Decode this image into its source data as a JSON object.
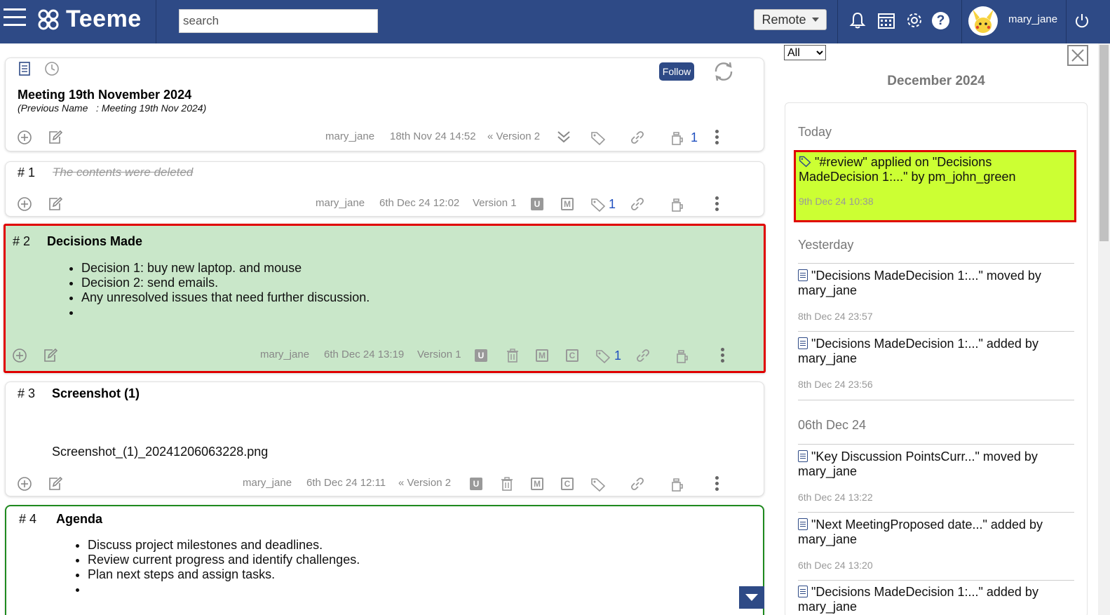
{
  "app": {
    "name": "Teeme"
  },
  "header": {
    "search_placeholder": "search",
    "mode_label": "Remote",
    "username": "mary_jane"
  },
  "doc": {
    "follow_label": "Follow",
    "title": "Meeting 19th November 2024",
    "prev_name": "(Previous Name   : Meeting 19th Nov 2024)",
    "author": "mary_jane",
    "date": "18th Nov 24 14:52",
    "version": "Version 2",
    "count": "1"
  },
  "sections": [
    {
      "num": "# 1",
      "deleted_text": "The contents were deleted",
      "author": "mary_jane",
      "date": "6th Dec 24 12:02",
      "version": "Version 1",
      "tag_count": "1"
    },
    {
      "num": "# 2",
      "title": "Decisions Made",
      "bullets": [
        "Decision 1: buy new laptop. and mouse",
        "Decision 2: send emails.",
        "Any unresolved issues that need further discussion.",
        ""
      ],
      "author": "mary_jane",
      "date": "6th Dec 24 13:19",
      "version": "Version 1",
      "tag_count": "1"
    },
    {
      "num": "# 3",
      "title": "Screenshot (1)",
      "file": "Screenshot_(1)_20241206063228.png",
      "author": "mary_jane",
      "date": "6th Dec 24 12:11",
      "version": "Version 2"
    },
    {
      "num": "# 4",
      "title": "Agenda",
      "bullets": [
        "Discuss project milestones and deadlines.",
        "Review current progress and identify challenges.",
        "Plan next steps and assign tasks.",
        ""
      ]
    }
  ],
  "letters": {
    "u": "U",
    "m": "M",
    "c": "C"
  },
  "activity": {
    "filter": "All",
    "month": "December 2024",
    "groups": [
      {
        "label": "Today",
        "items": [
          {
            "text": "\"#review\" applied on  \"Decisions MadeDecision 1:...\" by pm_john_green",
            "time": "9th Dec 24 10:38"
          }
        ]
      },
      {
        "label": "Yesterday",
        "items": [
          {
            "text": "\"Decisions MadeDecision 1:...\" moved by mary_jane",
            "time": "8th Dec 24 23:57"
          },
          {
            "text": "\"Decisions MadeDecision 1:...\" added by mary_jane",
            "time": "8th Dec 24 23:56"
          }
        ]
      },
      {
        "label": "06th Dec 24",
        "items": [
          {
            "text": "\"Key Discussion PointsCurr...\" moved by mary_jane",
            "time": "6th Dec 24 13:22"
          },
          {
            "text": "\"Next MeetingProposed date...\" added by mary_jane",
            "time": "6th Dec 24 13:20"
          },
          {
            "text": "\"Decisions MadeDecision 1:...\" added by mary_jane",
            "time": ""
          }
        ]
      }
    ]
  },
  "colors": {
    "header": "#2e4a86",
    "selected_bg": "#c9e7c9",
    "highlight": "#ccff33",
    "alert_border": "#e00000",
    "link_blue": "#1f4fbf"
  }
}
